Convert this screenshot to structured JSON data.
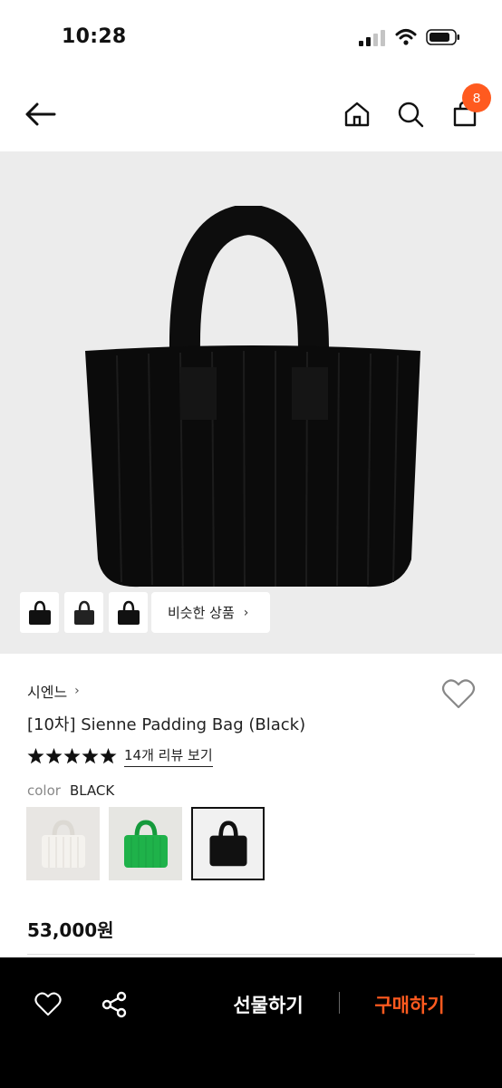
{
  "status_bar": {
    "time": "10:28",
    "icons": [
      "signal-icon",
      "wifi-icon",
      "battery-icon"
    ]
  },
  "header": {
    "icons": [
      "back-arrow-icon",
      "home-icon",
      "search-icon",
      "cart-icon"
    ],
    "cart_badge": "8",
    "accent_color": "#ff5a1f"
  },
  "gallery": {
    "thumbnails": [
      "bag-thumb-1",
      "bag-thumb-2",
      "bag-thumb-3"
    ],
    "similar_label": "비슷한 상품",
    "similar_chevron": "›"
  },
  "product": {
    "brand": "시엔느",
    "brand_chevron": "›",
    "title": "[10차] Sienne Padding Bag (Black)",
    "rating_stars": 5,
    "review_link": "14개 리뷰 보기",
    "color_label": "color",
    "color_value": "BLACK",
    "swatches": [
      {
        "name": "ivory",
        "color": "#f1efeb"
      },
      {
        "name": "green",
        "color": "#1fb24a"
      },
      {
        "name": "black",
        "color": "#111111",
        "selected": true
      }
    ],
    "price": "53,000원"
  },
  "bottom_bar": {
    "icons": [
      "heart-icon",
      "share-icon"
    ],
    "gift_label": "선물하기",
    "buy_label": "구매하기",
    "buy_color": "#ff5a1f"
  }
}
